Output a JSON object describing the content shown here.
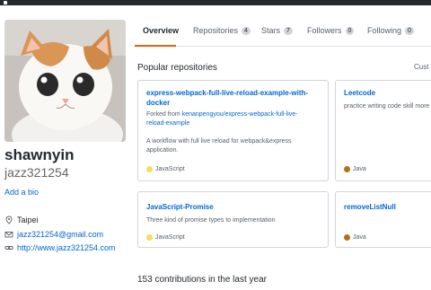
{
  "profile": {
    "fullname": "shawnyin",
    "username": "jazz321254",
    "add_bio": "Add a bio",
    "location": "Taipei",
    "email": "jazz321254@gmail.com",
    "website": "http://www.jazz321254.com"
  },
  "tabs": [
    {
      "label": "Overview",
      "count": ""
    },
    {
      "label": "Repositories",
      "count": "4"
    },
    {
      "label": "Stars",
      "count": "7"
    },
    {
      "label": "Followers",
      "count": "0"
    },
    {
      "label": "Following",
      "count": "0"
    }
  ],
  "popular": {
    "title": "Popular repositories",
    "customize": "Cust"
  },
  "repos": [
    {
      "name_line1": "express-webpack-full-live-reload-example-with-",
      "name_line2": "docker",
      "fork_prefix": "Forked from ",
      "fork_line1": "kenanpengyou/express-webpack-full-live-",
      "fork_line2": "reload-example",
      "desc_line1": "A workflow with full live reload for webpack&express",
      "desc_line2": "application.",
      "language": "JavaScript",
      "language_color": "#f1e05a"
    },
    {
      "name": "Leetcode",
      "desc": "practice writing code skill more",
      "language": "Java",
      "language_color": "#b07219"
    },
    {
      "name": "JavaScript-Promise",
      "desc": "Three kind of promise types to implementation",
      "language": "JavaScript",
      "language_color": "#f1e05a"
    },
    {
      "name": "removeListNull",
      "language": "Java",
      "language_color": "#b07219"
    }
  ],
  "contributions": "153 contributions in the last year",
  "icons": {
    "location": "location-pin-icon",
    "email": "mail-icon",
    "website": "link-icon"
  }
}
